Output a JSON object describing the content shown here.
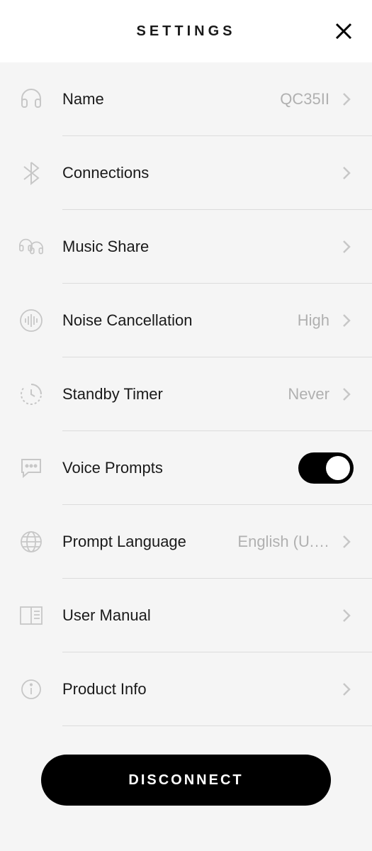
{
  "header": {
    "title": "SETTINGS"
  },
  "rows": {
    "name": {
      "label": "Name",
      "value": "QC35II"
    },
    "connections": {
      "label": "Connections"
    },
    "musicShare": {
      "label": "Music Share"
    },
    "noiseCancel": {
      "label": "Noise Cancellation",
      "value": "High"
    },
    "standby": {
      "label": "Standby Timer",
      "value": "Never"
    },
    "voice": {
      "label": "Voice Prompts",
      "toggle": true
    },
    "language": {
      "label": "Prompt Language",
      "value": "English (U.…"
    },
    "manual": {
      "label": "User Manual"
    },
    "product": {
      "label": "Product Info"
    }
  },
  "footer": {
    "disconnect": "DISCONNECT"
  },
  "icons": {
    "headphones": "headphones-icon",
    "bluetooth": "bluetooth-icon",
    "share": "music-share-icon",
    "noise": "noise-cancel-icon",
    "timer": "timer-icon",
    "chat": "chat-icon",
    "globe": "globe-icon",
    "book": "book-icon",
    "info": "info-icon"
  },
  "colors": {
    "iconStroke": "#c7c7c7",
    "text": "#1a1a1a",
    "valueText": "#b0b0b0",
    "divider": "#dcdcdc",
    "bg": "#f5f5f5",
    "accent": "#000000"
  }
}
